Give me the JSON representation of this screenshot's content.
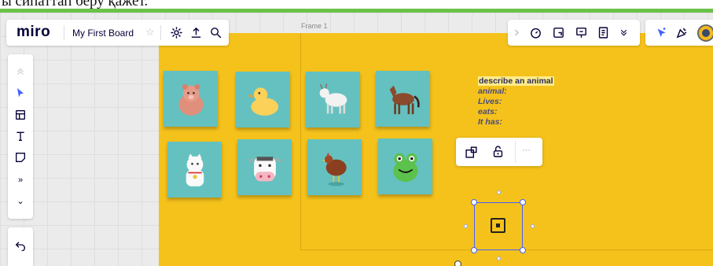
{
  "doc_fragment": "ы сипаттап беру қажет.",
  "app": {
    "logo": "miro",
    "board_name": "My First Board"
  },
  "frame": {
    "label": "Frame 1"
  },
  "text_block": {
    "title": "describe an animal",
    "lines": [
      "animal:",
      "Lives:",
      "eats:",
      "It has:"
    ]
  },
  "sidebar": {
    "more_label": "»",
    "expand_label": "⌄"
  },
  "context_toolbar": {
    "more_label": "···"
  },
  "sticky_notes": [
    {
      "animal": "bear-icon"
    },
    {
      "animal": "duck-icon"
    },
    {
      "animal": "goat-icon"
    },
    {
      "animal": "horse-icon"
    },
    {
      "animal": "lucky-cat-icon"
    },
    {
      "animal": "cow-icon"
    },
    {
      "animal": "hen-icon"
    },
    {
      "animal": "frog-icon"
    }
  ],
  "colors": {
    "frame": "#f5c21b",
    "sticky": "#65c1c0",
    "accent": "#4262ff",
    "brand_dark": "#050038",
    "top_line": "#6cc24a"
  }
}
